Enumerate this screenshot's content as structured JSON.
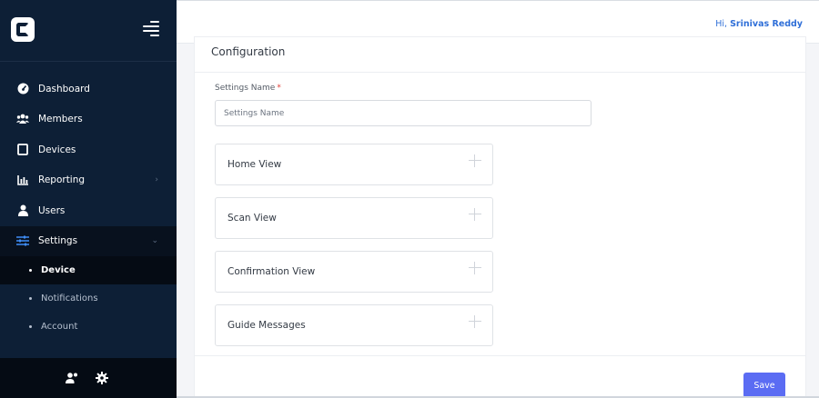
{
  "header": {
    "greeting": "Hi,",
    "user_name": "Srinivas Reddy"
  },
  "sidebar": {
    "logo": "C",
    "items": [
      {
        "label": "Dashboard",
        "icon": "dashboard-icon"
      },
      {
        "label": "Members",
        "icon": "members-icon"
      },
      {
        "label": "Devices",
        "icon": "devices-icon"
      },
      {
        "label": "Reporting",
        "icon": "reporting-icon",
        "chevron": "›"
      },
      {
        "label": "Users",
        "icon": "user-icon"
      },
      {
        "label": "Settings",
        "icon": "settings-sliders-icon",
        "chevron": "⌄"
      }
    ],
    "sub_items": [
      {
        "label": "Device"
      },
      {
        "label": "Notifications"
      },
      {
        "label": "Account"
      }
    ],
    "bottom_icons": [
      "user-settings-icon",
      "gear-icon"
    ]
  },
  "main": {
    "title": "Configuration",
    "field": {
      "label": "Settings Name",
      "required_mark": "*",
      "placeholder": "Settings Name",
      "value": ""
    },
    "accordions": [
      {
        "label": "Home View"
      },
      {
        "label": "Scan View"
      },
      {
        "label": "Confirmation View"
      },
      {
        "label": "Guide Messages"
      }
    ],
    "save_label": "Save"
  },
  "colors": {
    "sidebar_bg": "#0d1f36",
    "accent": "#5b6cf3",
    "link": "#2f6fd8",
    "required": "#e0413a"
  }
}
